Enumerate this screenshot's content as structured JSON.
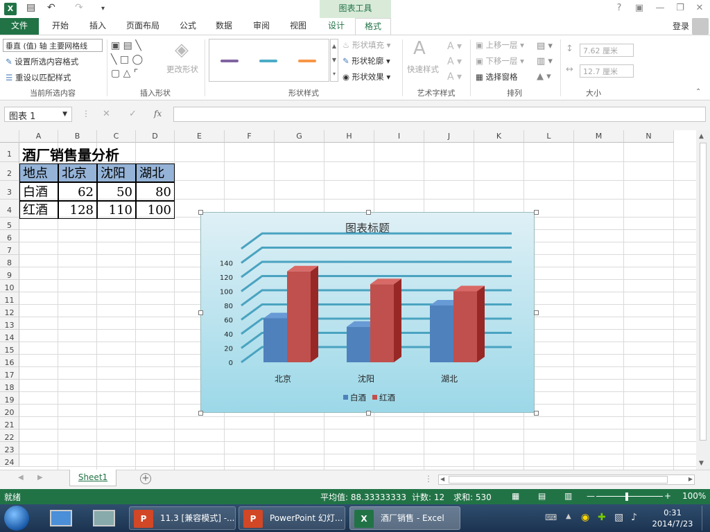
{
  "window": {
    "title": "酒厂销售 - Excel",
    "context_tools": "图表工具",
    "help": "?",
    "login": "登录"
  },
  "tabs": [
    "文件",
    "开始",
    "插入",
    "页面布局",
    "公式",
    "数据",
    "审阅",
    "视图",
    "设计",
    "格式"
  ],
  "ribbon": {
    "selection_combo": "垂直 (值) 轴 主要网格线",
    "format_selection": "设置所选内容格式",
    "reset_style": "重设以匹配样式",
    "group_current": "当前所选内容",
    "group_insert_shapes": "插入形状",
    "change_shape": "更改形状",
    "group_shape_styles": "形状样式",
    "shape_fill": "形状填充",
    "shape_outline": "形状轮廓",
    "shape_effects": "形状效果",
    "quick_styles": "快速样式",
    "group_wordart": "艺术字样式",
    "bring_forward": "上移一层",
    "send_backward": "下移一层",
    "selection_pane": "选择窗格",
    "group_arrange": "排列",
    "height": "7.62 厘米",
    "width": "12.7 厘米",
    "group_size": "大小",
    "swatch_colors": [
      "#8064a2",
      "#4bacc6",
      "#f79646"
    ]
  },
  "formula_bar": {
    "name_box": "图表 1",
    "fx": "fx",
    "value": ""
  },
  "columns": [
    "A",
    "B",
    "C",
    "D",
    "E",
    "F",
    "G",
    "H",
    "I",
    "J",
    "K",
    "L",
    "M",
    "N"
  ],
  "rows": [
    "1",
    "2",
    "3",
    "4",
    "5",
    "6",
    "7",
    "8",
    "9",
    "10",
    "11",
    "12",
    "13",
    "14",
    "15",
    "16",
    "17",
    "18",
    "19",
    "20",
    "21",
    "22",
    "23",
    "24"
  ],
  "table": {
    "title": "酒厂销售量分析",
    "header": [
      "地点",
      "北京",
      "沈阳",
      "湖北"
    ],
    "data": [
      [
        "白酒",
        "62",
        "50",
        "80"
      ],
      [
        "红酒",
        "128",
        "110",
        "100"
      ]
    ]
  },
  "sheet_tab": "Sheet1",
  "status": {
    "ready": "就绪",
    "average": "平均值: 88.33333333",
    "count": "计数: 12",
    "sum": "求和: 530",
    "zoom": "100%"
  },
  "taskbar": {
    "items": [
      "11.3 [兼容模式] -...",
      "PowerPoint 幻灯...",
      "酒厂销售 - Excel"
    ],
    "time": "0:31",
    "date": "2014/7/23"
  },
  "chart_data": {
    "type": "bar",
    "title": "图表标题",
    "categories": [
      "北京",
      "沈阳",
      "湖北"
    ],
    "series": [
      {
        "name": "白酒",
        "values": [
          62,
          50,
          80
        ],
        "color": "#4f81bd"
      },
      {
        "name": "红酒",
        "values": [
          128,
          110,
          100
        ],
        "color": "#c0504d"
      }
    ],
    "ylim": [
      0,
      160
    ],
    "yticks": [
      0,
      20,
      40,
      60,
      80,
      100,
      120,
      140
    ],
    "grid": true,
    "legend": "bottom",
    "gridline_color": "#4aa3c0"
  }
}
